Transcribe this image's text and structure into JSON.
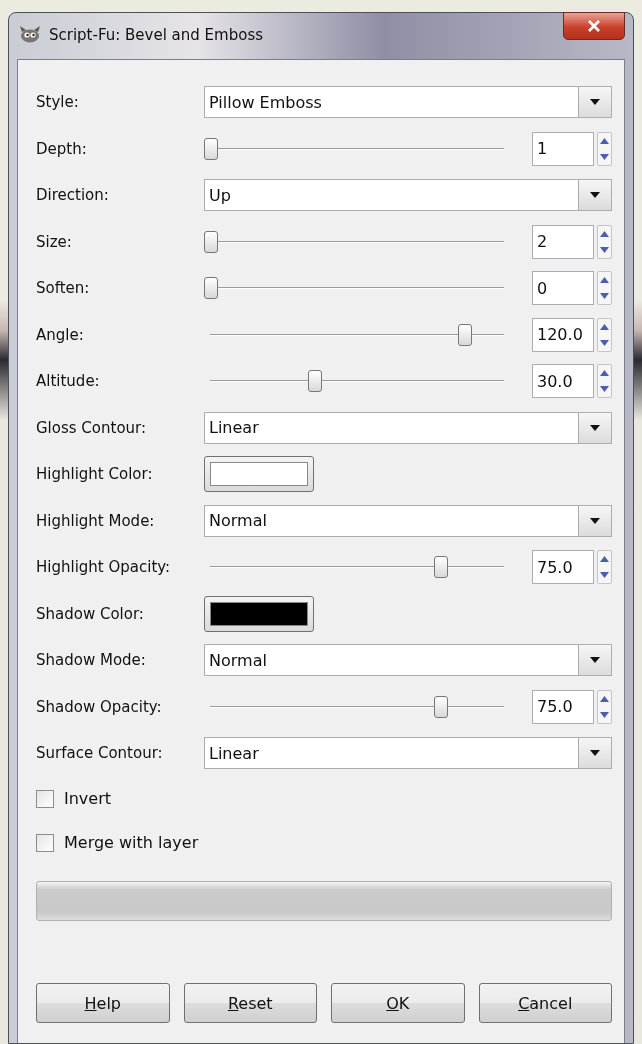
{
  "window": {
    "title": "Script-Fu: Bevel and Emboss"
  },
  "fields": [
    {
      "kind": "combo",
      "label": "Style:",
      "value": "Pillow Emboss"
    },
    {
      "kind": "slider",
      "label": "Depth:",
      "level": 0,
      "value": "1"
    },
    {
      "kind": "combo",
      "label": "Direction:",
      "value": "Up"
    },
    {
      "kind": "slider",
      "label": "Size:",
      "level": 0,
      "value": "2"
    },
    {
      "kind": "slider",
      "label": "Soften:",
      "level": 0,
      "value": "0"
    },
    {
      "kind": "slider",
      "label": "Angle:",
      "level": 0.83,
      "value": "120.0"
    },
    {
      "kind": "slider",
      "label": "Altitude:",
      "level": 0.34,
      "value": "30.0"
    },
    {
      "kind": "combo",
      "label": "Gloss Contour:",
      "value": "Linear"
    },
    {
      "kind": "color",
      "label": "Highlight Color:",
      "color": "#ffffff"
    },
    {
      "kind": "combo",
      "label": "Highlight Mode:",
      "value": "Normal"
    },
    {
      "kind": "slider",
      "label": "Highlight Opacity:",
      "level": 0.75,
      "value": "75.0"
    },
    {
      "kind": "color",
      "label": "Shadow Color:",
      "color": "#000000"
    },
    {
      "kind": "combo",
      "label": "Shadow Mode:",
      "value": "Normal"
    },
    {
      "kind": "slider",
      "label": "Shadow Opacity:",
      "level": 0.75,
      "value": "75.0"
    },
    {
      "kind": "combo",
      "label": "Surface Contour:",
      "value": "Linear"
    }
  ],
  "checkboxes": [
    {
      "label": "Invert",
      "checked": false
    },
    {
      "label": "Merge with layer",
      "checked": false
    }
  ],
  "progress_bar": {
    "level": 0
  },
  "buttons": [
    "Help",
    "Reset",
    "OK",
    "Cancel"
  ]
}
